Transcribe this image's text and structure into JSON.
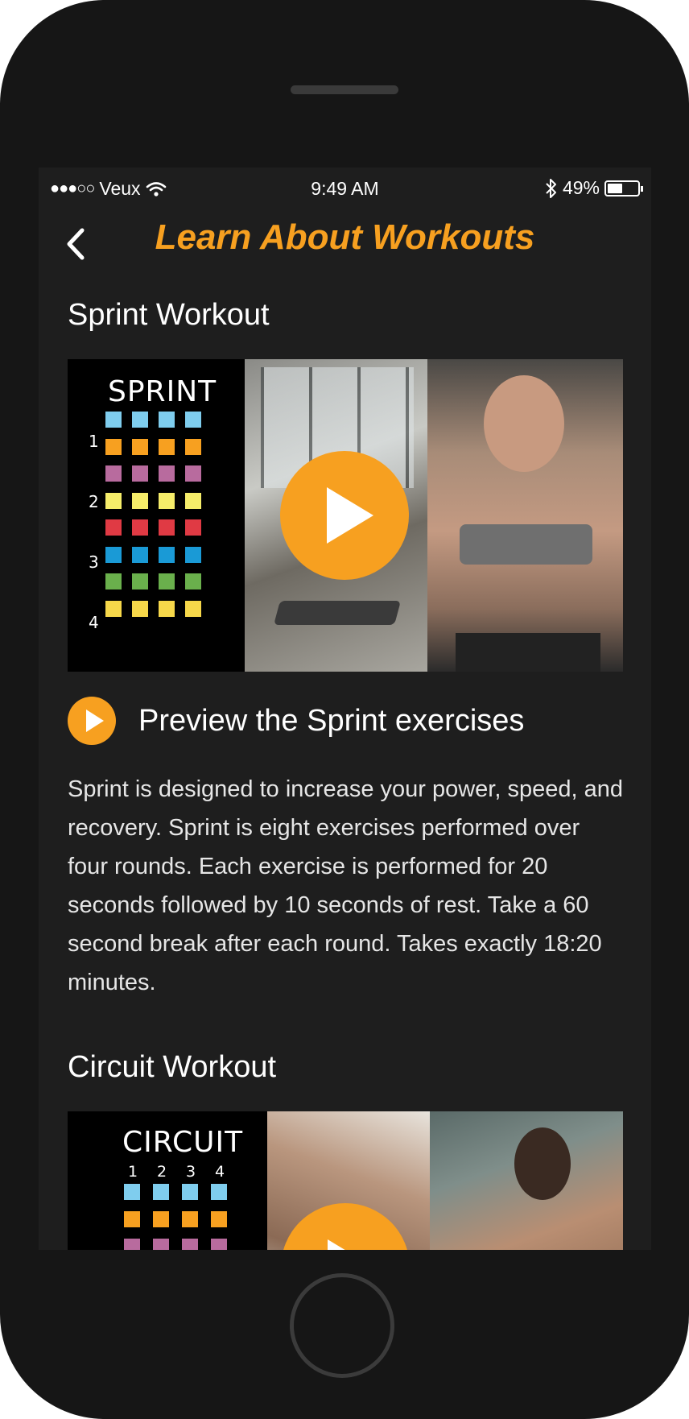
{
  "status": {
    "signal": "●●●○○",
    "carrier": "Veux",
    "time": "9:49 AM",
    "battery_text": "49%",
    "battery_level": 0.49,
    "icons": [
      "wifi-icon",
      "bluetooth-icon",
      "battery-icon"
    ]
  },
  "nav": {
    "title": "Learn About Workouts",
    "back_icon": "chevron-left-icon"
  },
  "colors": {
    "accent": "#f7a020",
    "background": "#1e1e1e",
    "text": "#ffffff"
  },
  "sections": [
    {
      "heading": "Sprint Workout",
      "thumb_label": "SPRINT",
      "round_labels": [
        "1",
        "2",
        "3",
        "4"
      ],
      "preview_label": "Preview the Sprint exercises",
      "description": "Sprint is designed to increase your power, speed, and recovery. Sprint is eight exercises performed over four rounds. Each exercise is performed for 20 seconds followed by 10 seconds of rest. Take a 60 second break after each round. Takes exactly 18:20 minutes."
    },
    {
      "heading": "Circuit Workout",
      "thumb_label": "CIRCUIT",
      "round_labels": [
        "1",
        "2",
        "3",
        "4"
      ]
    }
  ]
}
